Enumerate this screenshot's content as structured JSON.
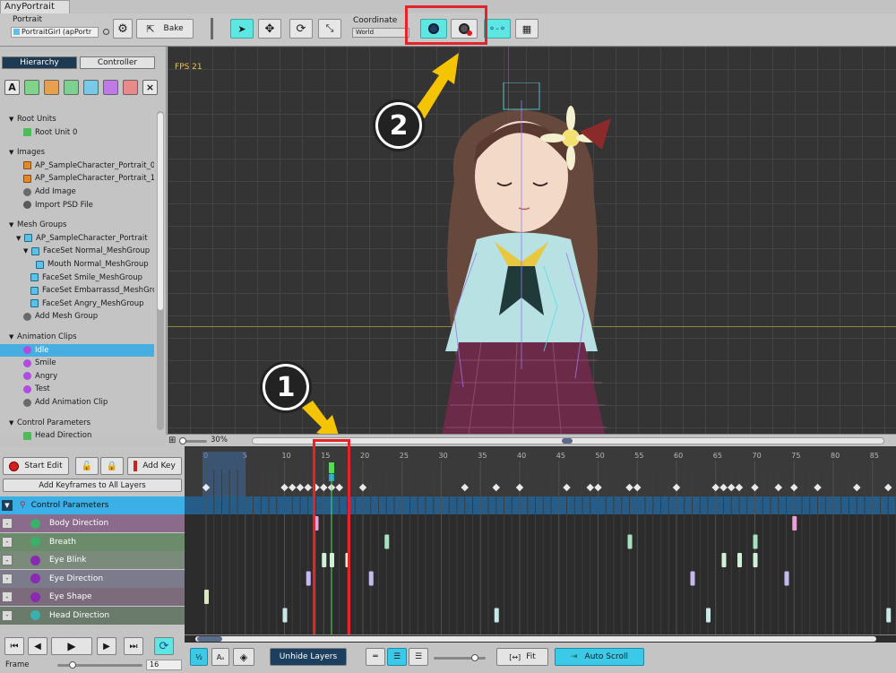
{
  "app": {
    "title": "AnyPortrait"
  },
  "toolbar": {
    "portrait_label": "Portrait",
    "portrait_value": "PortraitGirl (apPortr",
    "bake_label": "Bake",
    "coordinate_label": "Coordinate",
    "coordinate_value": "World"
  },
  "left_panel": {
    "tabs": [
      "Hierarchy",
      "Controller"
    ],
    "active_tab": "Hierarchy",
    "filter_icons": [
      "text-icon",
      "root-unit-icon",
      "image-icon",
      "mesh-icon",
      "mesh-group-icon",
      "animation-icon",
      "control-param-icon",
      "close-icon"
    ],
    "tree": [
      {
        "text": "Root Units",
        "kind": "header"
      },
      {
        "text": "Root Unit 0",
        "kind": "unit"
      },
      {
        "text": "Images",
        "kind": "header"
      },
      {
        "text": "AP_SampleCharacter_Portrait_0",
        "kind": "image"
      },
      {
        "text": "AP_SampleCharacter_Portrait_1",
        "kind": "image"
      },
      {
        "text": "Add Image",
        "kind": "add"
      },
      {
        "text": "Import PSD File",
        "kind": "psd"
      },
      {
        "text": "Mesh Groups",
        "kind": "header"
      },
      {
        "text": "AP_SampleCharacter_Portrait",
        "kind": "mesh"
      },
      {
        "text": "FaceSet Normal_MeshGroup",
        "kind": "mesh"
      },
      {
        "text": "Mouth Normal_MeshGroup",
        "kind": "mesh"
      },
      {
        "text": "FaceSet Smile_MeshGroup",
        "kind": "mesh"
      },
      {
        "text": "FaceSet Embarrassd_MeshGroup",
        "kind": "mesh"
      },
      {
        "text": "FaceSet Angry_MeshGroup",
        "kind": "mesh"
      },
      {
        "text": "Add Mesh Group",
        "kind": "add"
      },
      {
        "text": "Animation Clips",
        "kind": "header"
      },
      {
        "text": "Idle",
        "kind": "anim",
        "selected": true
      },
      {
        "text": "Smile",
        "kind": "anim"
      },
      {
        "text": "Angry",
        "kind": "anim"
      },
      {
        "text": "Test",
        "kind": "anim"
      },
      {
        "text": "Add Animation Clip",
        "kind": "add"
      },
      {
        "text": "Control Parameters",
        "kind": "header"
      },
      {
        "text": "Head Direction",
        "kind": "param"
      }
    ]
  },
  "viewport": {
    "fps": "FPS 21",
    "zoom": "30%",
    "callouts": [
      "2",
      "1"
    ]
  },
  "timeline": {
    "start_edit": "Start Edit",
    "add_key": "Add Key",
    "add_keyframes_all": "Add Keyframes to All Layers",
    "control_parameters": "Control Parameters",
    "layers": [
      {
        "name": "Body Direction",
        "color": "#8b6b8b"
      },
      {
        "name": "Breath",
        "color": "#6b8b6b"
      },
      {
        "name": "Eye Blink",
        "color": "#7b8b7b"
      },
      {
        "name": "Eye Direction",
        "color": "#7b7b8b"
      },
      {
        "name": "Eye Shape",
        "color": "#7b6b7b"
      },
      {
        "name": "Head Direction",
        "color": "#6b7b6b"
      }
    ],
    "ticks": [
      "0",
      "5",
      "10",
      "15",
      "20",
      "25",
      "30",
      "35",
      "40",
      "45",
      "50",
      "55",
      "60",
      "65",
      "70",
      "75",
      "80",
      "85"
    ],
    "current_frame": 16,
    "frame_label": "Frame",
    "frame_value": "16",
    "unhide_layers": "Unhide Layers",
    "fit": "Fit",
    "auto_scroll": "Auto Scroll"
  },
  "colors": {
    "accent_cyan": "#5ee6e2",
    "highlight_red": "#e3242b",
    "selection_blue": "#46aee0",
    "arrow_yellow": "#f5c400"
  }
}
